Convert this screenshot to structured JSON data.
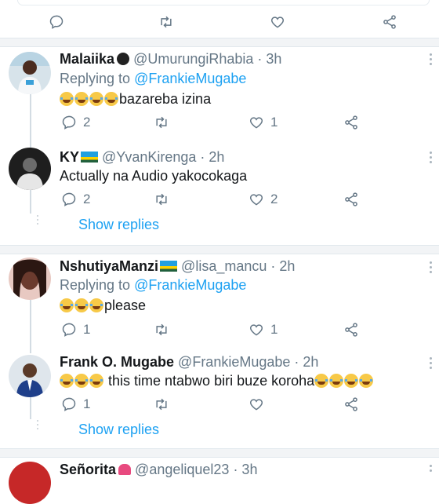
{
  "top_actions": {
    "reply": "",
    "retweet": "",
    "like": "",
    "share": ""
  },
  "tweets": [
    {
      "name": "Malaiika",
      "handle": "@UmurungiRhabia",
      "time": "· 3h",
      "reply_prefix": "Replying to ",
      "reply_to": "@FrankieMugabe",
      "text": "bazareba izina",
      "emoji_count": 4,
      "replies": "2",
      "retweets": "",
      "likes": "1"
    },
    {
      "name": "KY",
      "handle": "@YvanKirenga",
      "time": "· 2h",
      "text": "Actually na Audio yakocokaga",
      "replies": "2",
      "retweets": "",
      "likes": "2"
    },
    {
      "name": "NshutiyaManzi",
      "handle": "@lisa_mancu",
      "time": "· 2h",
      "reply_prefix": "Replying to ",
      "reply_to": "@FrankieMugabe",
      "text": "please",
      "emoji_count": 3,
      "replies": "1",
      "retweets": "",
      "likes": "1"
    },
    {
      "name": "Frank O. Mugabe",
      "handle": "@FrankieMugabe",
      "time": "· 2h",
      "text": " this time ntabwo biri buze koroha",
      "replies": "1",
      "retweets": "",
      "likes": ""
    },
    {
      "name": "Señorita",
      "handle": "@angeliquel23",
      "time": "· 3h"
    }
  ],
  "show_replies_label": "Show replies",
  "colors": {
    "accent": "#1da1f2",
    "muted": "#657786",
    "text": "#14171a"
  }
}
